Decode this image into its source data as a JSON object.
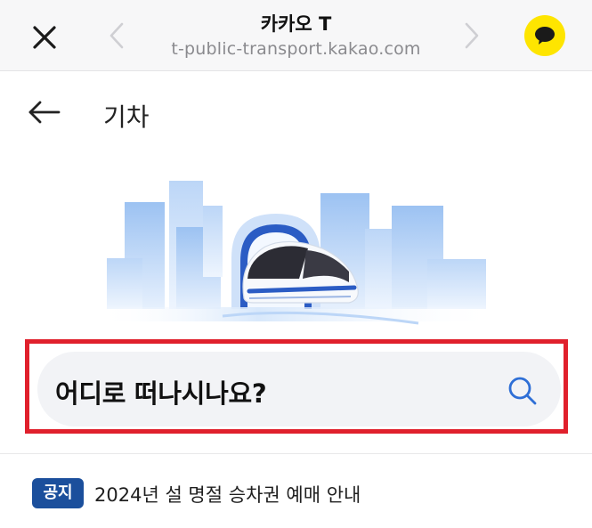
{
  "browser": {
    "title": "카카오 T",
    "url": "t-public-transport.kakao.com",
    "icons": [
      "close-icon",
      "chevron-left-icon",
      "chevron-right-icon",
      "kakaotalk-icon"
    ]
  },
  "page": {
    "title": "기차",
    "back_icon": "arrow-left-icon"
  },
  "search": {
    "placeholder": "어디로 떠나시나요?",
    "icon": "search-icon"
  },
  "notice": {
    "badge": "공지",
    "text": "2024년 설 명절 승차권 예매 안내"
  },
  "colors": {
    "accent_yellow": "#fee500",
    "badge_blue": "#1b4f9c",
    "highlight_red": "#e0202c",
    "search_bg": "#f2f3f6"
  }
}
